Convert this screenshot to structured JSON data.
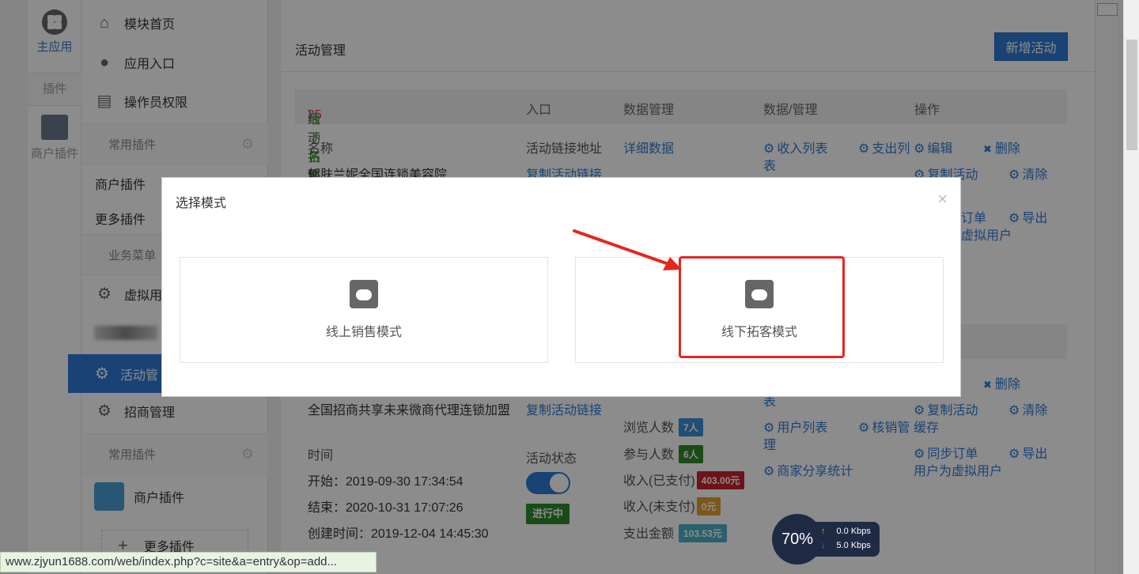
{
  "rail": {
    "main_app": "主应用",
    "plugin": "插件",
    "merchant_plugin": "商户插件"
  },
  "submenu": {
    "module_home": "模块首页",
    "app_entry": "应用入口",
    "operator_perm": "操作员权限",
    "common_plugins": "常用插件",
    "merchant_plugin": "商户插件",
    "more_plugins": "更多插件",
    "business_menu": "业务菜单",
    "virtual_user": "虚拟用",
    "activity_mgmt": "活动管",
    "invest_mgmt": "招商管理",
    "common_plugins_2": "常用插件",
    "merchant_plugin_2": "商户插件",
    "more_plugins_2": "更多插件"
  },
  "main": {
    "page_title": "活动管理",
    "add_button": "新增活动",
    "table_header": {
      "name_prefix": "活动名称(ID:",
      "id": "25",
      "sep": " - ",
      "mode": "线下拓客模式",
      "suffix": ")",
      "entry": "入口",
      "data_mgmt": "数据管理",
      "data_manage": "数据/管理",
      "ops": "操作"
    },
    "row1": {
      "name_label": "名称",
      "name": "郁肤兰妮全国连锁美容院",
      "link_label": "活动链接地址",
      "copy_link": "复制活动链接",
      "detail_data": "详细数据",
      "income_list": "收入列表",
      "income_list_wrap": "表",
      "expense_list": "支出列",
      "edit": "编辑",
      "delete": "删除",
      "copy_activity": "复制活动",
      "clear": "清除",
      "sync_order_tail": "订单",
      "virtual_user_tail": "虚拟用户",
      "export": "导出"
    },
    "row2": {
      "delete": "删除",
      "table_tail": "表",
      "name": "全国招商共享未来微商代理连锁加盟",
      "copy_link": "复制活动链接",
      "copy_activity": "复制活动",
      "clear": "清除",
      "browse_label": "浏览人数",
      "browse_value": "7人",
      "join_label": "参与人数",
      "join_value": "6人",
      "income_paid_label": "收入(已支付)",
      "income_paid_value": "403.00元",
      "income_unpaid_label": "收入(未支付)",
      "income_unpaid_value": "0元",
      "expense_label": "支出金额",
      "expense_value": "103.53元",
      "user_list": "用户列表",
      "user_list_wrap": "理",
      "verify_mgmt": "核销管",
      "cache": "缓存",
      "merchant_share": "商家分享统计",
      "sync_order": "同步订单",
      "user_to_virtual": "用户为虚拟用户",
      "export": "导出",
      "time_label": "时间",
      "start": "开始：2019-09-30 17:34:54",
      "end": "结束：2020-10-31 17:07:26",
      "created": "创建时间：2019-12-04 14:45:30",
      "status_label": "活动状态",
      "status_badge": "进行中"
    }
  },
  "modal": {
    "title": "选择模式",
    "close": "×",
    "online_mode": "线上销售模式",
    "offline_mode": "线下拓客模式"
  },
  "statusbar": {
    "url": "www.zjyun1688.com/web/index.php?c=site&a=entry&op=add..."
  },
  "speed": {
    "percent": "70%",
    "up": "0.0 Kbps",
    "down": "5.0 Kbps"
  },
  "colors": {
    "accent": "#2e7bd3",
    "highlight_red": "#e5261f",
    "id_red": "#d9372a",
    "mode_green": "#3aa233",
    "badge_blue": "#3d8fd6",
    "badge_green": "#2f8a2a",
    "badge_red": "#c8232c",
    "badge_orange": "#e0a030",
    "badge_teal": "#4ab0c8"
  }
}
